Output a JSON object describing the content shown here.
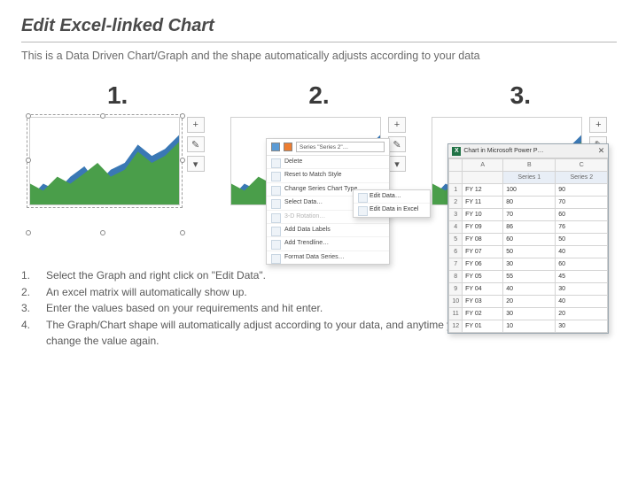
{
  "title": "Edit Excel-linked Chart",
  "subtitle": "This is a Data Driven Chart/Graph and the shape automatically adjusts according to your data",
  "step_labels": [
    "1.",
    "2.",
    "3."
  ],
  "sidebar_icons": {
    "plus": "+",
    "brush": "✎",
    "funnel": "▾"
  },
  "context_menu": {
    "selector_label": "Series \"Series 2\"…",
    "items": [
      {
        "label": "Delete",
        "disabled": false
      },
      {
        "label": "Reset to Match Style",
        "disabled": false
      },
      {
        "label": "Change Series Chart Type…",
        "disabled": false
      },
      {
        "label": "Select Data…",
        "disabled": false
      },
      {
        "label": "3-D Rotation…",
        "disabled": true
      },
      {
        "label": "Add Data Labels",
        "disabled": false
      },
      {
        "label": "Add Trendline…",
        "disabled": false
      },
      {
        "label": "Format Data Series…",
        "disabled": false
      }
    ],
    "submenu": [
      {
        "label": "Edit Data…"
      },
      {
        "label": "Edit Data in Excel"
      }
    ]
  },
  "spreadsheet": {
    "window_title": "Chart in Microsoft Power P…",
    "close_glyph": "✕",
    "excel_glyph": "X",
    "columns": [
      "",
      "A",
      "B",
      "C"
    ],
    "header_row": [
      "",
      "",
      "Series 1",
      "Series 2"
    ],
    "rows": [
      [
        "1",
        "FY 12",
        "100",
        "90"
      ],
      [
        "2",
        "FY 11",
        "80",
        "70"
      ],
      [
        "3",
        "FY 10",
        "70",
        "60"
      ],
      [
        "4",
        "FY 09",
        "86",
        "76"
      ],
      [
        "5",
        "FY 08",
        "60",
        "50"
      ],
      [
        "6",
        "FY 07",
        "50",
        "40"
      ],
      [
        "7",
        "FY 06",
        "30",
        "60"
      ],
      [
        "8",
        "FY 05",
        "55",
        "45"
      ],
      [
        "9",
        "FY 04",
        "40",
        "30"
      ],
      [
        "10",
        "FY 03",
        "20",
        "40"
      ],
      [
        "11",
        "FY 02",
        "30",
        "20"
      ],
      [
        "12",
        "FY 01",
        "10",
        "30"
      ]
    ]
  },
  "instructions": {
    "nums": [
      "1.",
      "2.",
      "3.",
      "4."
    ],
    "lines": [
      "Select the Graph and right click on \"Edit Data\".",
      "An excel matrix will automatically show up.",
      "Enter the values based on your requirements and hit enter.",
      "The Graph/Chart shape will automatically adjust according to your data, and anytime you change the value again."
    ]
  },
  "chart_data": {
    "type": "area",
    "categories": [
      "FY 01",
      "FY 02",
      "FY 03",
      "FY 04",
      "FY 05",
      "FY 06",
      "FY 07",
      "FY 08",
      "FY 09",
      "FY 10",
      "FY 11",
      "FY 12"
    ],
    "series": [
      {
        "name": "Series 1",
        "color": "#3a78b5",
        "values": [
          10,
          30,
          20,
          40,
          55,
          30,
          50,
          60,
          86,
          70,
          80,
          100
        ]
      },
      {
        "name": "Series 2",
        "color": "#4a9e4a",
        "values": [
          30,
          20,
          40,
          30,
          45,
          60,
          40,
          50,
          76,
          60,
          70,
          90
        ]
      }
    ],
    "ylim": [
      0,
      100
    ]
  }
}
